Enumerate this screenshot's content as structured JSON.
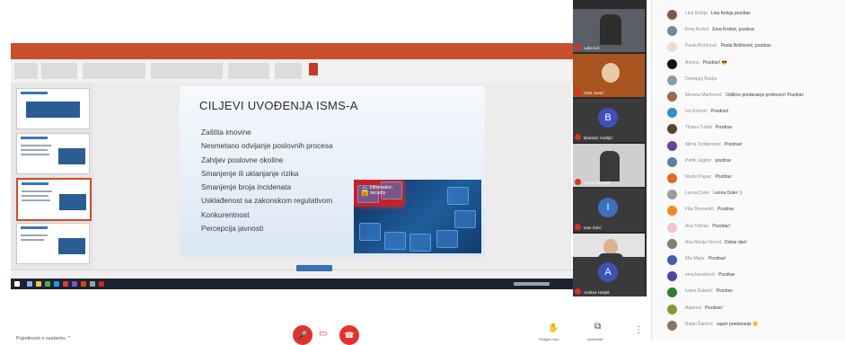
{
  "slide": {
    "title": "CILJEVI UVOĐENJA ISMS-A",
    "bullets": [
      "Zaštita imovine",
      "Nesmetano odvijanje poslovnih procesa",
      "Zahtjev poslovne okoline",
      "Smanjenje ili uklanjanje rizika",
      "Smanjenje broja incidenata",
      "Usklađenost sa zakonskom regulativom",
      "Konkurentnost",
      "Percepcija javnosti"
    ],
    "image_text": "information security"
  },
  "tiles": [
    {
      "name": "Luka Ivić",
      "avatar": ""
    },
    {
      "name": "Ante Juraić",
      "avatar": ""
    },
    {
      "name": "Branimir Andrijić",
      "avatar": "B",
      "color": "#3f51b5"
    },
    {
      "name": "Jurica Žanović",
      "avatar": ""
    },
    {
      "name": "Ivan Šolić",
      "avatar": "I",
      "color": "#3f6fbf"
    },
    {
      "name": "Marko Ivić",
      "avatar": ""
    },
    {
      "name": "Andrea Horjak",
      "avatar": "A",
      "color": "#3f51b5"
    }
  ],
  "chat": [
    {
      "name": "Lina Keleja",
      "text": "Lina Keleja pozdrav",
      "color": "#7a5b4a"
    },
    {
      "name": "Ema Krobot",
      "text": "Ema Krobot, pozdrav",
      "color": "#7b8794"
    },
    {
      "name": "Paola Božinović",
      "text": "Paola Božinović, pozdrav",
      "color": "#f3d9cf"
    },
    {
      "name": "Antony",
      "text": "Pozdrav! 😎",
      "color": "#111111"
    },
    {
      "name": "Domagoj Buzija",
      "text": "",
      "color": "#8e9aa6"
    },
    {
      "name": "Morena Martinović",
      "text": "Odlično predavanje profesore! Pozdrav",
      "color": "#9a6b4f"
    },
    {
      "name": "Iva Kokorić",
      "text": "Pozdrav!",
      "color": "#2f8fd6"
    },
    {
      "name": "Tihana Tušek",
      "text": "Pozdrav",
      "color": "#5a4030"
    },
    {
      "name": "Mirna Tomljenović",
      "text": "Pozdrav!",
      "color": "#6f3fa0"
    },
    {
      "name": "Patrik Jagber",
      "text": "pozdrav",
      "color": "#5f7f95"
    },
    {
      "name": "Marko Papac",
      "text": "Pozdrav",
      "color": "#e06a24"
    },
    {
      "name": "Leona Duler",
      "text": "Leona Duler :)",
      "color": "#9c9c9c"
    },
    {
      "name": "Filip Bernardić",
      "text": "Pozdrav",
      "color": "#f08a1a"
    },
    {
      "name": "Ana Tolman",
      "text": "Pozdrav!",
      "color": "#f2c6c6"
    },
    {
      "name": "Ana Marija Horvat",
      "text": "Dobar dan!",
      "color": "#8a7a6a"
    },
    {
      "name": "Mia Major",
      "text": "Pozdrav!",
      "color": "#4a5aa8"
    },
    {
      "name": "ema kovačević",
      "text": "Pozdrav",
      "color": "#5a3fa0"
    },
    {
      "name": "Ivana Dukarić",
      "text": "Pozdrav",
      "color": "#2e7d32"
    },
    {
      "name": "Algorovi",
      "text": "Pozdrav!",
      "color": "#7f9a3a"
    },
    {
      "name": "Bojan Šarlerić",
      "text": "super predavanje 🙂",
      "color": "#8a7560"
    }
  ],
  "bottom": {
    "details": "Pojedinosti o sastanku",
    "raise_hand": "Podigni ruku",
    "activities": "Aktivnosti"
  },
  "colors": {
    "accent_red": "#e0332a",
    "ppt_orange": "#c94e2c"
  }
}
